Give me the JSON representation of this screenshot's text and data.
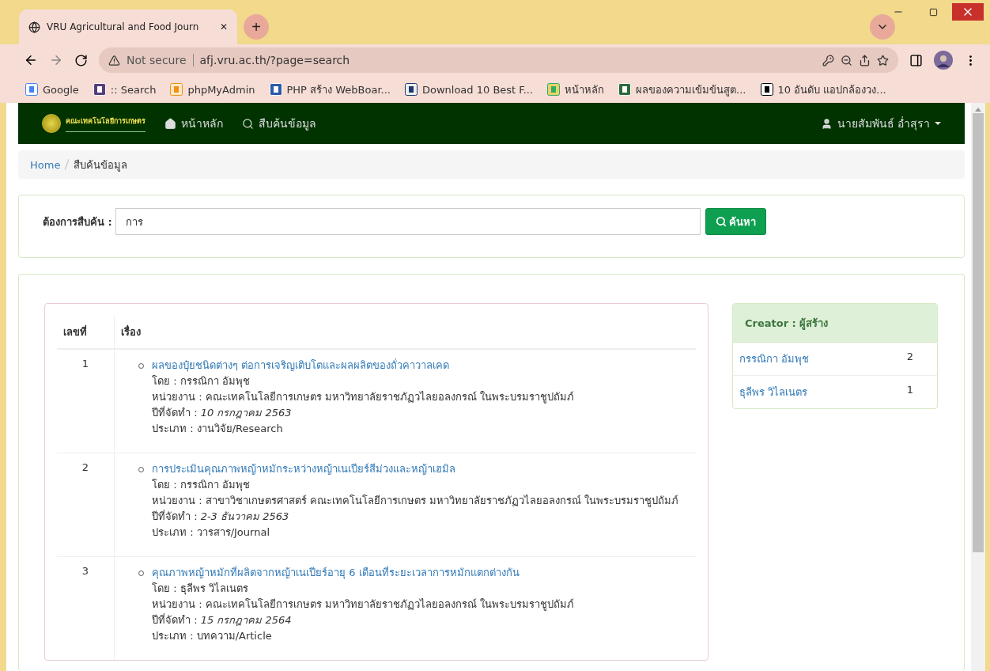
{
  "browser": {
    "tab_title": "VRU Agricultural and Food Journ",
    "close": "✕",
    "new_tab": "+",
    "security": "Not secure",
    "url": "afj.vru.ac.th/?page=search",
    "bookmarks": [
      {
        "label": "Google",
        "kind": "google"
      },
      {
        "label": ":: Search",
        "kind": "b"
      },
      {
        "label": "phpMyAdmin",
        "kind": "pma"
      },
      {
        "label": "PHP สร้าง WebBoar...",
        "kind": "doc"
      },
      {
        "label": "Download 10 Best F...",
        "kind": "h"
      },
      {
        "label": "หน้าหลัก",
        "kind": "seal"
      },
      {
        "label": "ผลของความเข้มข้นสูต...",
        "kind": "chart"
      },
      {
        "label": "10 อันดับ แอปกล้องวง...",
        "kind": "m"
      }
    ]
  },
  "navbar": {
    "logo_text": "คณะเทคโนโลยีการเกษตร",
    "items": [
      {
        "label": "หน้าหลัก",
        "kind": "home"
      },
      {
        "label": "สืบค้นข้อมูล",
        "kind": "search"
      }
    ],
    "user": "นายสัมพันธ์ อ่ำสุรา"
  },
  "breadcrumb": [
    {
      "label": "Home",
      "selected": false
    },
    {
      "label": "สืบค้นข้อมูล",
      "selected": true
    }
  ],
  "search": {
    "label": "ต้องการสืบค้น :",
    "value": "การ",
    "button": "ค้นหา"
  },
  "results": {
    "columns": [
      "เลขที่",
      "เรื่อง"
    ],
    "rows": [
      {
        "number": "1",
        "title": "ผลของปุ๋ยชนิดต่างๆ ต่อการเจริญเติบโตและผลผลิตของถั่วคาวาลเคด",
        "fields": [
          {
            "label": "โดย :",
            "value": "กรรณิกา อัมพุช",
            "kind": "plain"
          },
          {
            "label": "หน่วยงาน :",
            "value": "คณะเทคโนโลยีการเกษตร มหาวิทยาลัยราชภัฏวไลยอลงกรณ์ ในพระบรมราชูปถัมภ์",
            "kind": "plain"
          },
          {
            "label": "ปีที่จัดทำ :",
            "value": "10 กรกฎาคม 2563",
            "kind": "date"
          },
          {
            "label": "ประเภท :",
            "value": "งานวิจัย/Research",
            "kind": "plain"
          }
        ]
      },
      {
        "number": "2",
        "title": "การประเมินคุณภาพหญ้าหมักระหว่างหญ้าเนเปียร์สีม่วงและหญ้าเฮมิล",
        "fields": [
          {
            "label": "โดย :",
            "value": "กรรณิกา อัมพุช",
            "kind": "plain"
          },
          {
            "label": "หน่วยงาน :",
            "value": "สาขาวิชาเกษตรศาสตร์ คณะเทคโนโลยีการเกษตร มหาวิทยาลัยราชภัฏวไลยอลงกรณ์ ในพระบรมราชูปถัมภ์",
            "kind": "plain"
          },
          {
            "label": "ปีที่จัดทำ :",
            "value": "2-3 ธันวาคม 2563",
            "kind": "date"
          },
          {
            "label": "ประเภท :",
            "value": "วารสาร/Journal",
            "kind": "plain"
          }
        ]
      },
      {
        "number": "3",
        "title": "คุณภาพหญ้าหมักที่ผลิตจากหญ้าเนเปียร์อายุ 6 เดือนที่ระยะเวลาการหมักแตกต่างกัน",
        "fields": [
          {
            "label": "โดย :",
            "value": "ธุลีพร วิไลเนตร",
            "kind": "plain"
          },
          {
            "label": "หน่วยงาน :",
            "value": "คณะเทคโนโลยีการเกษตร มหาวิทยาลัยราชภัฏวไลยอลงกรณ์ ในพระบรมราชูปถัมภ์",
            "kind": "plain"
          },
          {
            "label": "ปีที่จัดทำ :",
            "value": "15 กรกฎาคม 2564",
            "kind": "date"
          },
          {
            "label": "ประเภท :",
            "value": "บทความ/Article",
            "kind": "plain"
          }
        ]
      }
    ]
  },
  "creators": {
    "title": "Creator : ผู้สร้าง",
    "items": [
      {
        "name": "กรรณิกา อัมพุช",
        "count": "2"
      },
      {
        "name": "ธุลีพร วิไลเนตร",
        "count": "1"
      }
    ]
  }
}
